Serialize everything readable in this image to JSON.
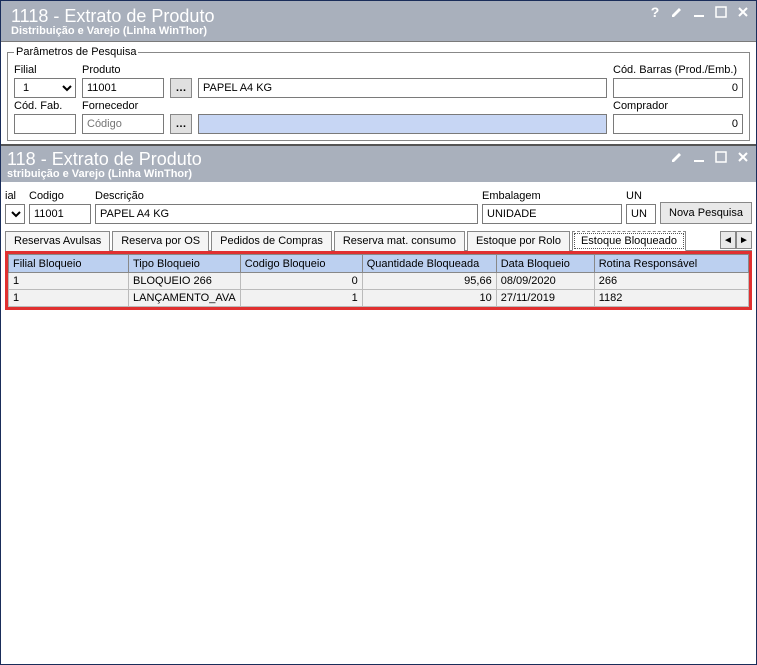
{
  "outer": {
    "title": "1118 - Extrato de Produto",
    "subtitle": "Distribuição e Varejo (Linha WinThor)",
    "params_legend": "Parâmetros de Pesquisa",
    "filial_label": "Filial",
    "filial_value": "1",
    "produto_label": "Produto",
    "produto_value": "11001",
    "produto_desc": "PAPEL A4 KG",
    "codbarras_label": "Cód. Barras (Prod./Emb.)",
    "codbarras_value": "0",
    "codfab_label": "Cód. Fab.",
    "codfab_value": "",
    "fornecedor_label": "Fornecedor",
    "fornecedor_placeholder": "Código",
    "comprador_label": "Comprador",
    "comprador_value": "0"
  },
  "inner": {
    "title": "118 - Extrato de Produto",
    "subtitle": "stribuição e Varejo (Linha WinThor)",
    "filial_label": "ial",
    "codigo_label": "Codigo",
    "codigo_value": "11001",
    "descricao_label": "Descrição",
    "descricao_value": "PAPEL A4 KG",
    "embalagem_label": "Embalagem",
    "embalagem_value": "UNIDADE",
    "un_label": "UN",
    "un_value": "UN",
    "nova_pesquisa": "Nova Pesquisa",
    "tabs": [
      {
        "label": "Reservas Avulsas"
      },
      {
        "label": "Reserva por OS"
      },
      {
        "label": "Pedidos de Compras"
      },
      {
        "label": "Reserva mat. consumo"
      },
      {
        "label": "Estoque por Rolo"
      },
      {
        "label": "Estoque Bloqueado"
      }
    ],
    "active_tab_index": 5,
    "grid": {
      "columns": [
        "Filial Bloqueio",
        "Tipo Bloqueio",
        "Codigo Bloqueio",
        "Quantidade Bloqueada",
        "Data Bloqueio",
        "Rotina Responsável"
      ],
      "rows": [
        {
          "filial": "1",
          "tipo": "BLOQUEIO 266",
          "codigo": "0",
          "qtd": "95,66",
          "data": "08/09/2020",
          "rotina": "266"
        },
        {
          "filial": "1",
          "tipo": "LANÇAMENTO_AVA",
          "codigo": "1",
          "qtd": "10",
          "data": "27/11/2019",
          "rotina": "1182"
        }
      ]
    }
  }
}
